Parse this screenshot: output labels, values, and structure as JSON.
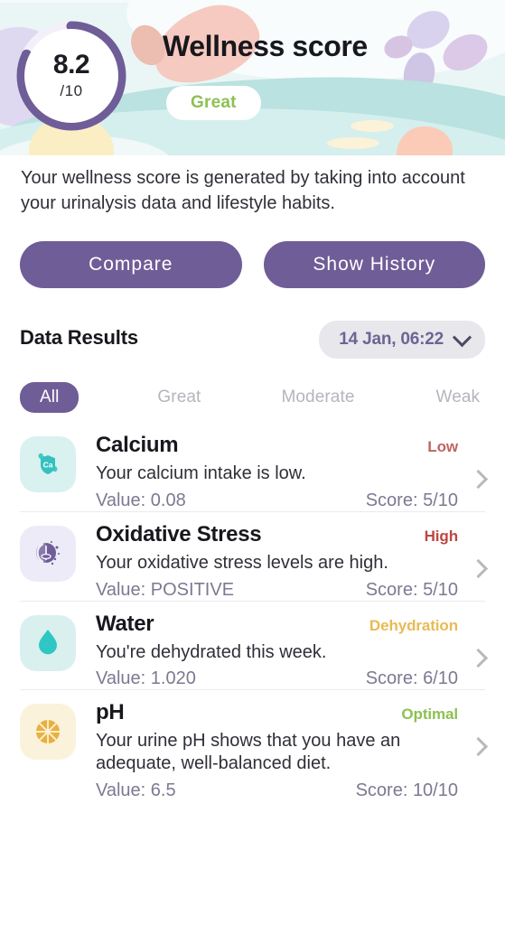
{
  "header": {
    "title": "Wellness score",
    "score_value": "8.2",
    "score_denominator": "/10",
    "score_number": 8.2,
    "score_max": 10,
    "badge": "Great",
    "badge_color": "#8cc152",
    "ring_color": "#6f5d97",
    "background_color": "#eaf6f5"
  },
  "description": "Your wellness score is generated by taking into account your urinalysis data and lifestyle habits.",
  "actions": {
    "compare_label": "Compare",
    "history_label": "Show History",
    "button_color": "#6f5d97"
  },
  "results": {
    "heading": "Data Results",
    "date_label": "14 Jan, 06:22",
    "filters": [
      {
        "label": "All",
        "active": true
      },
      {
        "label": "Great",
        "active": false
      },
      {
        "label": "Moderate",
        "active": false
      },
      {
        "label": "Weak",
        "active": false
      }
    ],
    "items": [
      {
        "title": "Calcium",
        "status": "Low",
        "status_color": "#c0655f",
        "description": "Your calcium intake is low.",
        "value_label": "Value: 0.08",
        "score_label": "Score: 5/10",
        "icon": "calcium-molecule-icon"
      },
      {
        "title": "Oxidative Stress",
        "status": "High",
        "status_color": "#c0453f",
        "description": "Your oxidative stress levels are high.",
        "value_label": "Value: POSITIVE",
        "score_label": "Score: 5/10",
        "icon": "oxidative-stress-icon"
      },
      {
        "title": "Water",
        "status": "Dehydration",
        "status_color": "#e8bb54",
        "description": "You're dehydrated this week.",
        "value_label": "Value: 1.020",
        "score_label": "Score: 6/10",
        "icon": "water-droplet-icon"
      },
      {
        "title": "pH",
        "status": "Optimal",
        "status_color": "#8cc152",
        "description": "Your urine pH shows that you have an adequate, well-balanced diet.",
        "value_label": "Value: 6.5",
        "score_label": "Score: 10/10",
        "icon": "ph-citrus-icon"
      }
    ]
  }
}
